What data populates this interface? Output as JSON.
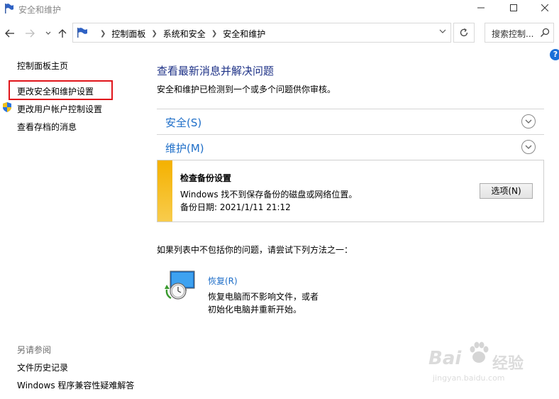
{
  "window": {
    "title": "安全和维护"
  },
  "address_bar": {
    "crumbs": [
      "控制面板",
      "系统和安全",
      "安全和维护"
    ],
    "search_placeholder": "搜索控制..."
  },
  "left_pane": {
    "links": [
      "控制面板主页",
      "更改安全和维护设置",
      "更改用户帐户控制设置",
      "查看存档的消息"
    ],
    "see_also_label": "另请参阅",
    "see_also_links": [
      "文件历史记录",
      "Windows 程序兼容性疑难解答"
    ]
  },
  "main": {
    "title": "查看最新消息并解决问题",
    "subtitle": "安全和维护已检测到一个或多个问题供你审核。",
    "sections": [
      "安全(S)",
      "维护(M)"
    ],
    "message": {
      "title": "检查备份设置",
      "line1": "Windows 找不到保存备份的磁盘或网络位置。",
      "line2": "备份日期: 2021/1/11 21:12",
      "button": "选项(N)"
    },
    "try_text": "如果列表中不包括你的问题，请尝试下列方法之一：",
    "recovery": {
      "link": "恢复(R)",
      "line1": "恢复电脑而不影响文件，或者",
      "line2": "初始化电脑并重新开始。"
    }
  },
  "watermark": {
    "brand": "Bai",
    "brand_cn": "经验",
    "url": "jingyan.baidu.com"
  },
  "colors": {
    "link_blue": "#1e6ec8",
    "title_blue": "#1e3287",
    "warning_yellow": "#f4b100",
    "highlight_red": "#e0151b"
  }
}
